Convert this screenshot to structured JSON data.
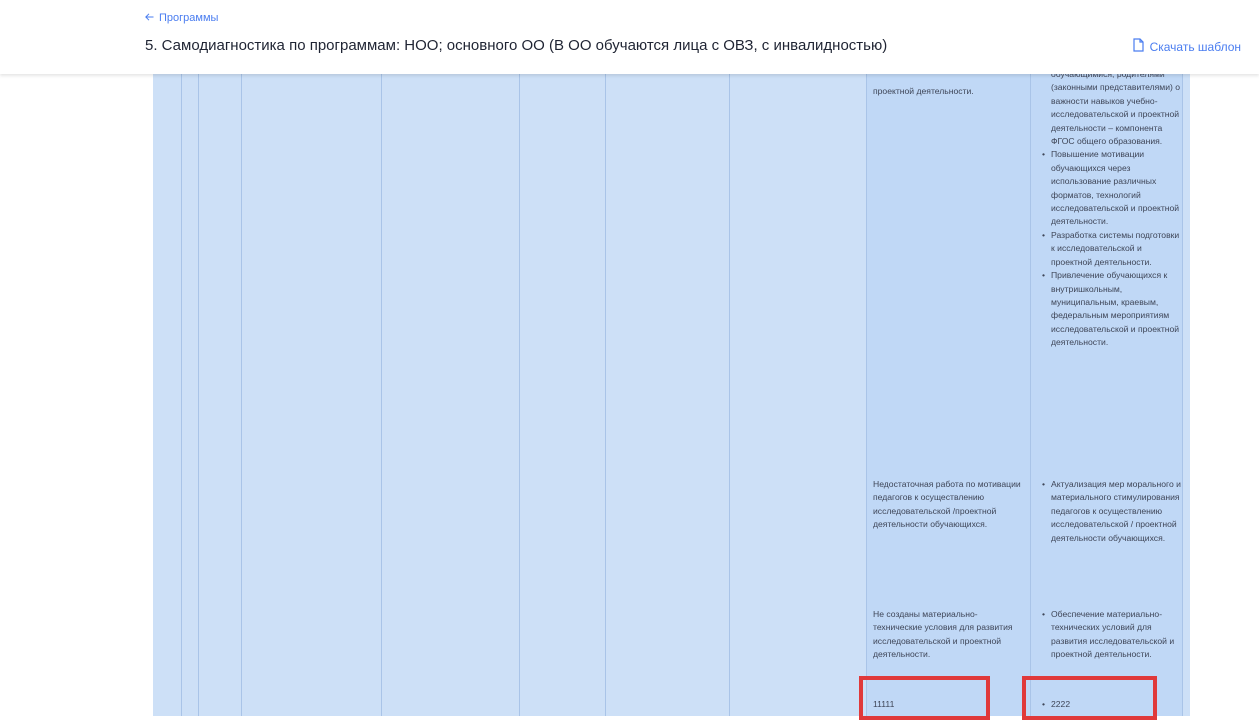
{
  "header": {
    "back_label": "Программы",
    "title": "5. Самодиагностика по программам: НОО; основного ОО (В ОО обучаются лица с ОВЗ, с инвалидностью)",
    "download_label": "Скачать шаблон"
  },
  "table": {
    "rows": [
      {
        "problem": "проектной деятельности.",
        "actions": [
          "обучающимися, родителями (законными представителями) о важности навыков учебно-исследовательской и проектной деятельности – компонента ФГОС общего образования.",
          "Повышение мотивации обучающихся через использование различных форматов, технологий исследовательской и проектной деятельности.",
          "Разработка системы подготовки к исследовательской и проектной деятельности.",
          "Привлечение обучающихся к внутришкольным, муниципальным, краевым, федеральным мероприятиям исследовательской и проектной деятельности."
        ]
      },
      {
        "problem": "Недостаточная работа по мотивации педагогов к осуществлению исследовательской /проектной деятельности обучающихся.",
        "actions": [
          "Актуализация мер морального и материального стимулирования педагогов к осуществлению исследовательской / проектной деятельности обучающихся."
        ]
      },
      {
        "problem": "Не созданы материально-технические условия для развития исследовательской и проектной деятельности.",
        "actions": [
          "Обеспечение материально-технических условий для развития исследовательской и проектной деятельности."
        ]
      },
      {
        "problem": "11111",
        "actions": [
          "2222"
        ]
      }
    ]
  },
  "colors": {
    "accent": "#4a7df0",
    "table_bg": "#cde0f7",
    "highlight_box": "#e0393a"
  }
}
